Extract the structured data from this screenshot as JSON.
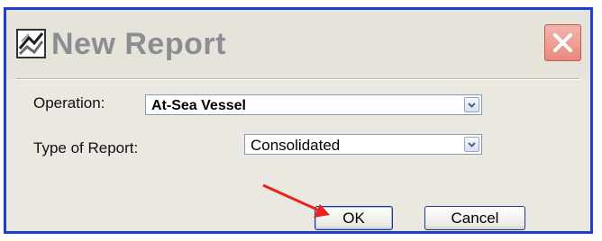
{
  "dialog": {
    "title": "New Report",
    "close_icon": "close-icon",
    "app_icon": "report-app-icon"
  },
  "form": {
    "operation_label": "Operation:",
    "operation_value": "At-Sea Vessel",
    "report_type_label": "Type of Report:",
    "report_type_value": "Consolidated"
  },
  "buttons": {
    "ok_label": "OK",
    "cancel_label": "Cancel"
  },
  "annotation": {
    "arrow_color": "#e8221c",
    "icon": "red-arrow-icon"
  },
  "colors": {
    "frame_border": "#1f3fcf",
    "close_button": "#e8897f"
  }
}
